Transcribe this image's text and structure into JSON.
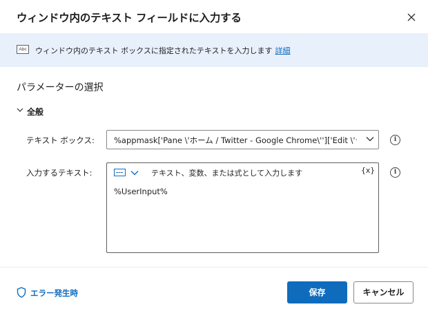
{
  "dialog": {
    "title": "ウィンドウ内のテキスト フィールドに入力する",
    "close_icon": "close-icon"
  },
  "info": {
    "icon": "text-box-icon",
    "icon_text": "Abc",
    "text": "ウィンドウ内のテキスト ボックスに指定されたテキストを入力します",
    "link": "詳細"
  },
  "parameters": {
    "title": "パラメーターの選択",
    "group": {
      "label": "全般",
      "expanded": true
    },
    "fields": {
      "text_box": {
        "label": "テキスト ボックス:",
        "value": "%appmask['Pane \\'ホーム / Twitter - Google Chrome\\'']['Edit \\'テキス"
      },
      "input_text": {
        "label": "入力するテキスト:",
        "placeholder": "テキスト、変数、または式として入力します",
        "variable_button": "{x}",
        "value": "%UserInput%"
      },
      "help_icon_glyph": "i"
    }
  },
  "footer": {
    "error_link": "エラー発生時",
    "save_label": "保存",
    "cancel_label": "キャンセル"
  },
  "colors": {
    "accent": "#0f6cbd",
    "info_bar": "#e8f0fc"
  }
}
